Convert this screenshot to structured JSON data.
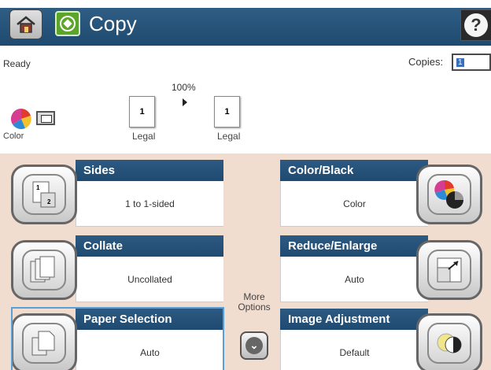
{
  "header": {
    "title": "Copy",
    "home_icon": "home-icon",
    "app_icon": "copy-icon",
    "help_icon": "help-icon"
  },
  "status": {
    "text": "Ready",
    "copies_label": "Copies:",
    "copies_value": "1"
  },
  "preview": {
    "zoom": "100%",
    "color_label": "Color",
    "original": {
      "page_number": "1",
      "size": "Legal"
    },
    "output": {
      "page_number": "1",
      "size": "Legal"
    }
  },
  "tiles": {
    "sides": {
      "title": "Sides",
      "value": "1 to 1-sided"
    },
    "color_black": {
      "title": "Color/Black",
      "value": "Color"
    },
    "collate": {
      "title": "Collate",
      "value": "Uncollated"
    },
    "reduce_enlarge": {
      "title": "Reduce/Enlarge",
      "value": "Auto"
    },
    "paper_selection": {
      "title": "Paper Selection",
      "value": "Auto"
    },
    "image_adjustment": {
      "title": "Image Adjustment",
      "value": "Default"
    }
  },
  "more_options": {
    "line1": "More",
    "line2": "Options"
  },
  "colors": {
    "title_bar": "#1f4a70",
    "panel_bg": "#f1ddcf",
    "copy_icon": "#5aa52a",
    "selection": "#5aa0d8"
  }
}
